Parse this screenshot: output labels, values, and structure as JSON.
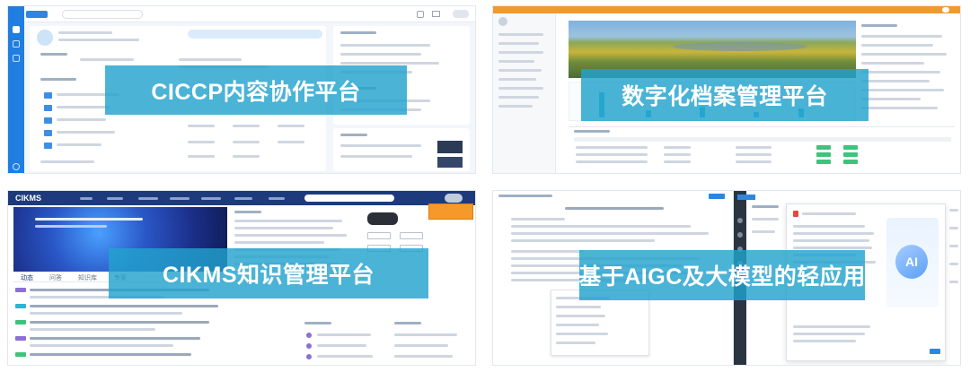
{
  "panels": [
    {
      "title": "CICCP内容协作平台"
    },
    {
      "title": "数字化档案管理平台"
    },
    {
      "title": "CIKMS知识管理平台"
    },
    {
      "title": "基于AIGC及大模型的轻应用"
    }
  ],
  "p3": {
    "logo": "CIKMS",
    "tabs": [
      "动态",
      "问答",
      "知识库",
      "专家"
    ]
  },
  "p4": {
    "ai_badge": "AI"
  },
  "colors": {
    "banner": "#22a2cd",
    "sidebar_blue": "#1f7ee0",
    "header_orange": "#f09a2c",
    "header_navy": "#1d3b7c"
  }
}
